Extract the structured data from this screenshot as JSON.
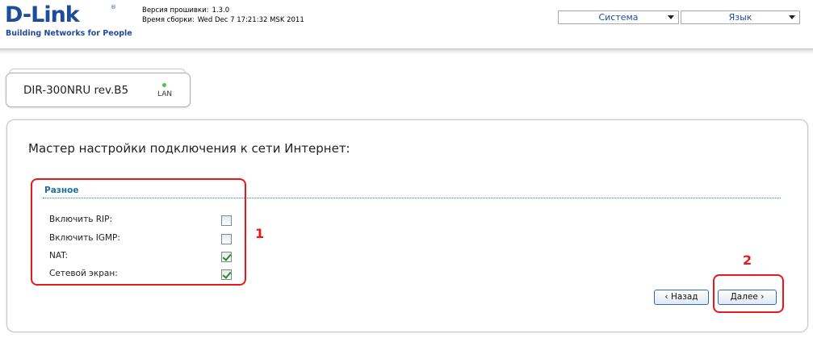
{
  "header": {
    "logo_text": "D-Link",
    "logo_tagline": "Building Networks for People",
    "firmware_label": "Версия прошивки:",
    "firmware_value": "1.3.0",
    "build_label": "Время сборки:",
    "build_value": "Wed Dec 7 17:21:32 MSK 2011",
    "menu_system": "Система",
    "menu_language": "Язык"
  },
  "device": {
    "name": "DIR-300NRU rev.B5",
    "lan_label": "LAN"
  },
  "wizard": {
    "title": "Мастер настройки подключения к сети Интернет:",
    "section_title": "Разное",
    "options": [
      {
        "label": "Включить RIP:",
        "checked": false
      },
      {
        "label": "Включить IGMP:",
        "checked": false
      },
      {
        "label": "NAT:",
        "checked": true
      },
      {
        "label": "Сетевой экран:",
        "checked": true
      }
    ],
    "back_button": "‹ Назад",
    "next_button": "Далее ›"
  },
  "annotations": {
    "mark_1": "1",
    "mark_2": "2",
    "color": "#e8181c"
  },
  "colors": {
    "brand_blue": "#1e4b9b",
    "section_blue": "#1e6e9e"
  }
}
